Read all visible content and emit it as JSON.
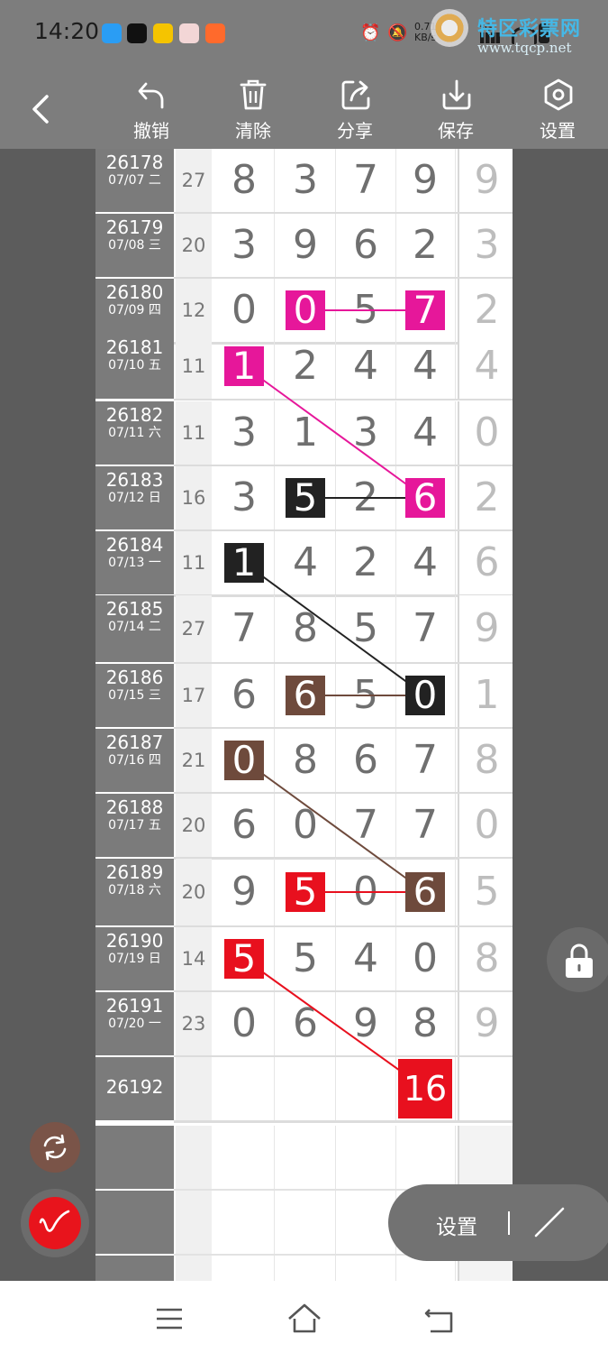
{
  "status_bar": {
    "time": "14:20",
    "net_speed_line1": "0.71",
    "net_speed_line2": "KB/s",
    "signal_label": "5G",
    "watermark_title": "特区彩票网",
    "watermark_url": "www.tqcp.net"
  },
  "toolbar": {
    "back_icon": "chevron-left-icon",
    "undo_label": "撤销",
    "clear_label": "清除",
    "share_label": "分享",
    "save_label": "保存",
    "settings_label": "设置"
  },
  "table": {
    "rows": [
      {
        "issue": "26178",
        "date": "07/07 二",
        "sum": "27",
        "digits": [
          "8",
          "3",
          "7",
          "9"
        ],
        "extra": "9"
      },
      {
        "issue": "26179",
        "date": "07/08 三",
        "sum": "20",
        "digits": [
          "3",
          "9",
          "6",
          "2"
        ],
        "extra": "3"
      },
      {
        "issue": "26180",
        "date": "07/09 四",
        "sum": "12",
        "digits": [
          "0",
          "0",
          "5",
          "7"
        ],
        "extra": "2"
      },
      {
        "issue": "26181",
        "date": "07/10 五",
        "sum": "11",
        "digits": [
          "1",
          "2",
          "4",
          "4"
        ],
        "extra": "4"
      },
      {
        "issue": "26182",
        "date": "07/11 六",
        "sum": "11",
        "digits": [
          "3",
          "1",
          "3",
          "4"
        ],
        "extra": "0"
      },
      {
        "issue": "26183",
        "date": "07/12 日",
        "sum": "16",
        "digits": [
          "3",
          "5",
          "2",
          "6"
        ],
        "extra": "2"
      },
      {
        "issue": "26184",
        "date": "07/13 一",
        "sum": "11",
        "digits": [
          "1",
          "4",
          "2",
          "4"
        ],
        "extra": "6"
      },
      {
        "issue": "26185",
        "date": "07/14 二",
        "sum": "27",
        "digits": [
          "7",
          "8",
          "5",
          "7"
        ],
        "extra": "9"
      },
      {
        "issue": "26186",
        "date": "07/15 三",
        "sum": "17",
        "digits": [
          "6",
          "6",
          "5",
          "0"
        ],
        "extra": "1"
      },
      {
        "issue": "26187",
        "date": "07/16 四",
        "sum": "21",
        "digits": [
          "0",
          "8",
          "6",
          "7"
        ],
        "extra": "8"
      },
      {
        "issue": "26188",
        "date": "07/17 五",
        "sum": "20",
        "digits": [
          "6",
          "0",
          "7",
          "7"
        ],
        "extra": "0"
      },
      {
        "issue": "26189",
        "date": "07/18 六",
        "sum": "20",
        "digits": [
          "9",
          "5",
          "0",
          "6"
        ],
        "extra": "5"
      },
      {
        "issue": "26190",
        "date": "07/19 日",
        "sum": "14",
        "digits": [
          "5",
          "5",
          "4",
          "0"
        ],
        "extra": "8"
      },
      {
        "issue": "26191",
        "date": "07/20 一",
        "sum": "23",
        "digits": [
          "0",
          "6",
          "9",
          "8"
        ],
        "extra": "9"
      },
      {
        "issue": "26192",
        "date": "",
        "sum": "",
        "digits": [
          "",
          "",
          "",
          ""
        ],
        "extra": ""
      }
    ],
    "highlights": [
      {
        "row": 2,
        "col": 1,
        "text": "0",
        "color": "#e6179a"
      },
      {
        "row": 2,
        "col": 3,
        "text": "7",
        "color": "#e6179a"
      },
      {
        "row": 3,
        "col": 0,
        "text": "1",
        "color": "#e6179a"
      },
      {
        "row": 5,
        "col": 3,
        "text": "6",
        "color": "#e6179a"
      },
      {
        "row": 5,
        "col": 1,
        "text": "5",
        "color": "#222222"
      },
      {
        "row": 6,
        "col": 0,
        "text": "1",
        "color": "#222222"
      },
      {
        "row": 8,
        "col": 3,
        "text": "0",
        "color": "#222222"
      },
      {
        "row": 8,
        "col": 1,
        "text": "6",
        "color": "#6e4a3c"
      },
      {
        "row": 9,
        "col": 0,
        "text": "0",
        "color": "#6e4a3c"
      },
      {
        "row": 11,
        "col": 3,
        "text": "6",
        "color": "#6e4a3c"
      },
      {
        "row": 11,
        "col": 1,
        "text": "5",
        "color": "#e8101e"
      },
      {
        "row": 12,
        "col": 0,
        "text": "5",
        "color": "#e8101e"
      },
      {
        "row": 14,
        "col": 3,
        "text": "16",
        "color": "#e8101e"
      }
    ],
    "connections": [
      {
        "from": [
          2,
          1
        ],
        "to": [
          2,
          3
        ],
        "color": "#e6179a"
      },
      {
        "from": [
          3,
          0
        ],
        "to": [
          5,
          3
        ],
        "color": "#e6179a"
      },
      {
        "from": [
          5,
          1
        ],
        "to": [
          5,
          3
        ],
        "color": "#222222"
      },
      {
        "from": [
          6,
          0
        ],
        "to": [
          8,
          3
        ],
        "color": "#222222"
      },
      {
        "from": [
          8,
          1
        ],
        "to": [
          8,
          3
        ],
        "color": "#6e4a3c"
      },
      {
        "from": [
          9,
          0
        ],
        "to": [
          11,
          3
        ],
        "color": "#6e4a3c"
      },
      {
        "from": [
          11,
          1
        ],
        "to": [
          11,
          3
        ],
        "color": "#e8101e"
      },
      {
        "from": [
          12,
          0
        ],
        "to": [
          14,
          3
        ],
        "color": "#e8101e"
      }
    ]
  },
  "floating": {
    "refresh_icon": "refresh-icon",
    "pen_icon": "pen-icon",
    "lock_icon": "lock-icon",
    "settings_label": "设置",
    "line_tool_icon": "line-tool-icon"
  },
  "nav_bar": {
    "menu_icon": "menu-icon",
    "home_icon": "home-icon",
    "back_icon": "back-icon"
  }
}
